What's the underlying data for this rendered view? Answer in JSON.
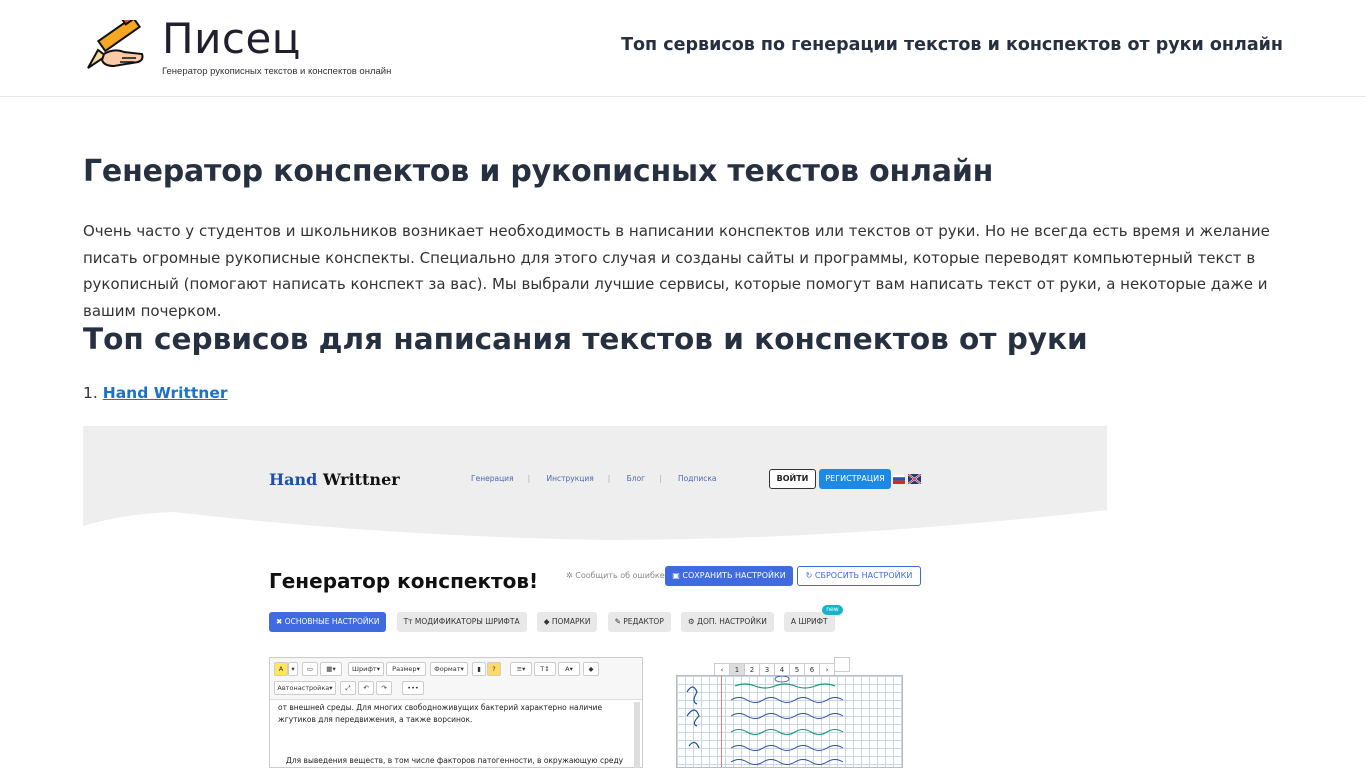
{
  "header": {
    "site_title": "Писец",
    "tagline": "Генератор рукописных текстов и конспектов онлайн",
    "top_link": "Топ сервисов по генерации текстов и конспектов от руки онлайн"
  },
  "article": {
    "title": "Генератор конспектов и рукописных текстов онлайн",
    "intro": "Очень часто у студентов и школьников возникает необходимость в написании конспектов или текстов от руки. Но не всегда есть время и желание писать огромные рукописные конспекты. Специально для этого случая и созданы сайты и программы, которые переводят компьютерный текст в рукописный (помогают написать конспект за вас). Мы выбрали лучшие сервисы, которые помогут вам написать текст от руки, а некоторые даже и вашим почерком.",
    "subtitle": "Топ сервисов для написания текстов и конспектов от руки",
    "list": [
      {
        "number": "1.",
        "label": "Hand Writtner"
      }
    ]
  },
  "screenshot": {
    "logo_part1": "Hand",
    "logo_part2": "Writtner",
    "nav": [
      "Генерация",
      "Инструкция",
      "Блог",
      "Подписка"
    ],
    "login": "ВОЙТИ",
    "register": "РЕГИСТРАЦИЯ",
    "gen_title": "Генератор конспектов!",
    "report": "Сообщить об ошибке",
    "save": "СОХРАНИТЬ НАСТРОЙКИ",
    "reset": "СБРОСИТЬ НАСТРОЙКИ",
    "tabs": [
      "ОСНОВНЫЕ НАСТРОЙКИ",
      "МОДИФИКАТОРЫ ШРИФТА",
      "ПОМАРКИ",
      "РЕДАКТОР",
      "ДОП. НАСТРОЙКИ",
      "ШРИФТ"
    ],
    "tab_badge": "new",
    "toolbar": {
      "font": "Шрифт",
      "size": "Размер",
      "format": "Формат",
      "auto": "Автонастройка",
      "help": "?",
      "more": "•••"
    },
    "editor_text": "от внешней среды. Для многих свободноживущих бактерий характерно наличие жгутиков для передвижения, а также ворсинок.",
    "editor_text2": "Для выведения веществ, в том числе факторов патогенности, в окружающую среду",
    "pages": [
      "‹",
      "1",
      "2",
      "3",
      "4",
      "5",
      "6",
      "›",
      ""
    ]
  },
  "colors": {
    "link": "#1a73c8",
    "primary_button": "#3f6ae0",
    "register_button": "#1e88e5",
    "heading": "#263040"
  }
}
